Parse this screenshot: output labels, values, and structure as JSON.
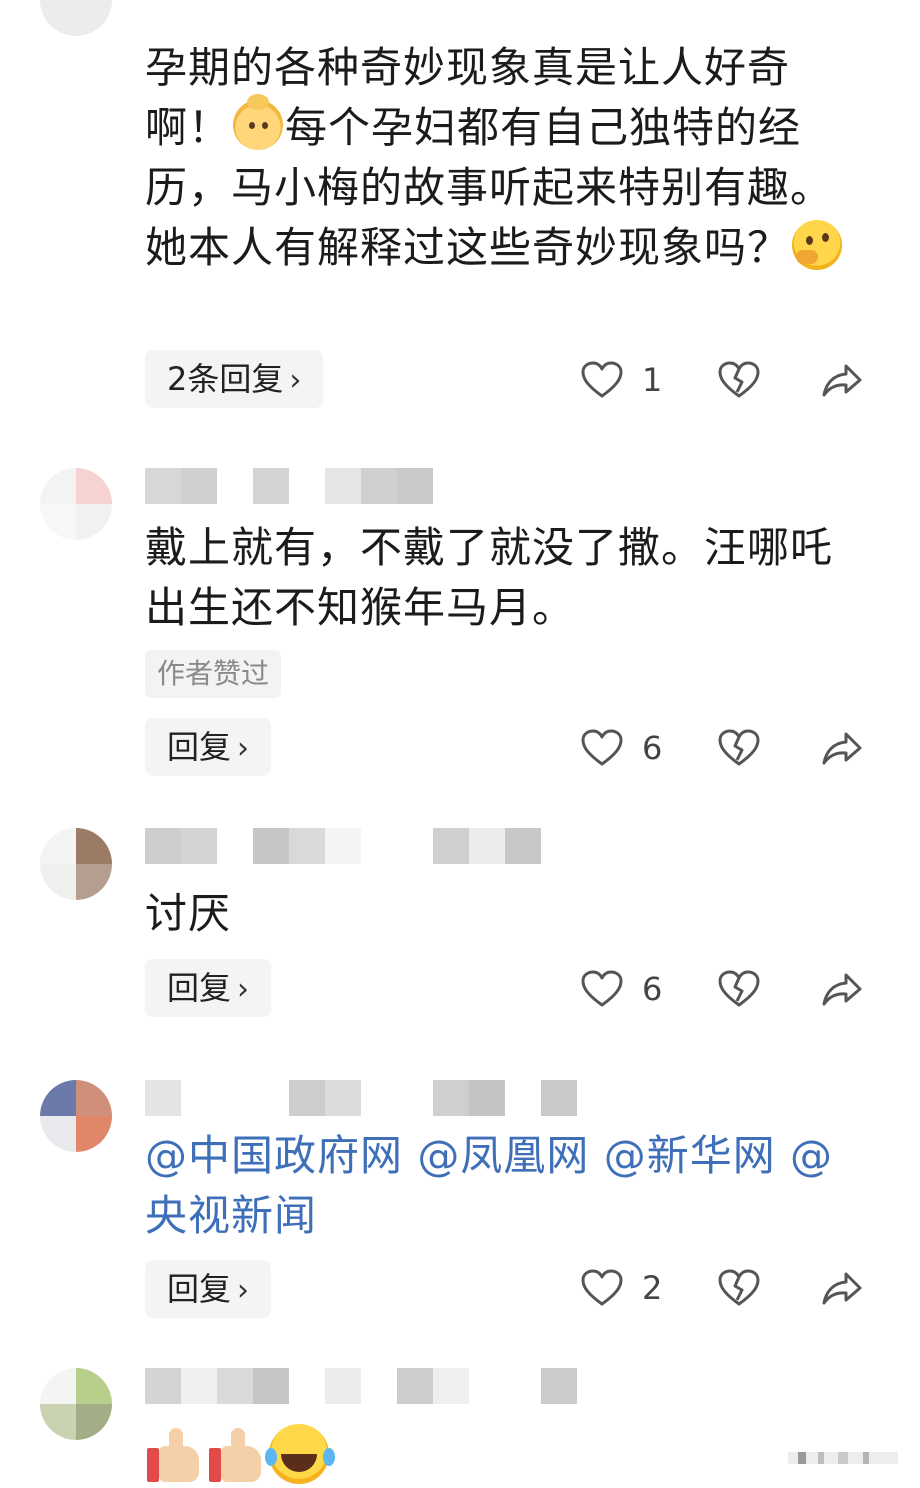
{
  "comments": [
    {
      "text_before_emoji1": "孕期的各种奇妙现象真是让人好奇啊！",
      "text_mid": "每个孕妇都有自己独特的经历，马小梅的故事听起来特别有趣。她本人有解释过这些奇妙现象吗？",
      "reply_label": "2条回复",
      "like_count": "1"
    },
    {
      "text": "戴上就有，不戴了就没了撒。汪哪吒出生还不知猴年马月。",
      "author_liked_tag": "作者赞过",
      "reply_label": "回复",
      "like_count": "6"
    },
    {
      "text": "讨厌",
      "reply_label": "回复",
      "like_count": "6"
    },
    {
      "text": "@中国政府网 @凤凰网 @新华网 @央视新闻",
      "reply_label": "回复",
      "like_count": "2"
    }
  ],
  "icons": {
    "like": "heart-outline-icon",
    "dislike": "broken-heart-icon",
    "share": "share-arrow-icon",
    "chevron": "chevron-right-icon"
  },
  "chevron_glyph": "›",
  "colors": {
    "link": "#3e6fb8",
    "text": "#1b1b1b",
    "button_bg": "#f4f4f4",
    "icon": "#555555"
  }
}
